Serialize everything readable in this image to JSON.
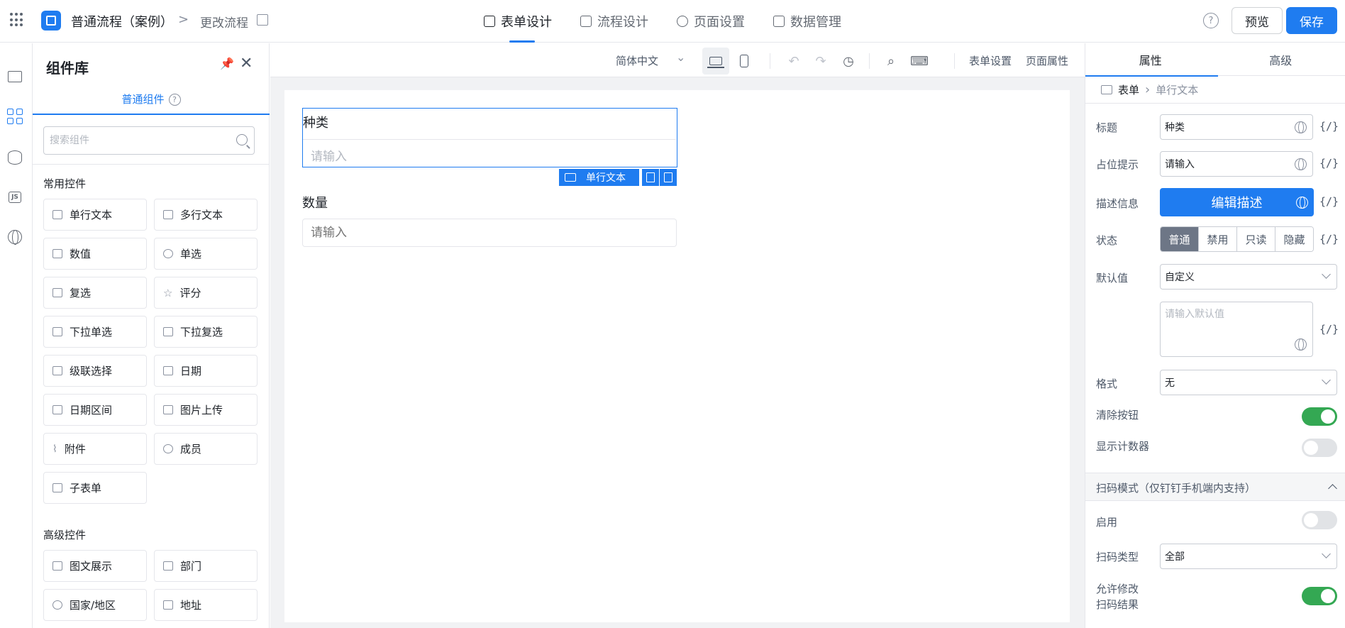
{
  "header": {
    "app_name": "普通流程（案例）",
    "breadcrumb_sep": ">",
    "current_page": "更改流程",
    "tabs": [
      {
        "label": "表单设计",
        "active": true
      },
      {
        "label": "流程设计",
        "active": false
      },
      {
        "label": "页面设置",
        "active": false
      },
      {
        "label": "数据管理",
        "active": false
      }
    ],
    "help": "?",
    "preview_label": "预览",
    "save_label": "保存"
  },
  "rail": {
    "js_label": "JS"
  },
  "library": {
    "title": "组件库",
    "tab_label": "普通组件",
    "help": "?",
    "search_placeholder": "搜索组件",
    "common_title": "常用控件",
    "common_items": [
      "单行文本",
      "多行文本",
      "数值",
      "单选",
      "复选",
      "评分",
      "下拉单选",
      "下拉复选",
      "级联选择",
      "日期",
      "日期区间",
      "图片上传",
      "附件",
      "成员",
      "子表单"
    ],
    "advanced_title": "高级控件",
    "advanced_items": [
      "图文展示",
      "部门",
      "国家/地区",
      "地址"
    ]
  },
  "toolbar": {
    "language": "简体中文",
    "form_settings": "表单设置",
    "page_props": "页面属性"
  },
  "canvas": {
    "fields": [
      {
        "label": "种类",
        "placeholder": "请输入",
        "selected": true
      },
      {
        "label": "数量",
        "placeholder": "请输入",
        "selected": false
      }
    ],
    "selected_tag": "单行文本"
  },
  "props": {
    "tabs": [
      {
        "label": "属性",
        "active": true
      },
      {
        "label": "高级",
        "active": false
      }
    ],
    "breadcrumb": {
      "root": "表单",
      "current": "单行文本"
    },
    "rows": {
      "title_label": "标题",
      "title_value": "种类",
      "placeholder_label": "占位提示",
      "placeholder_value": "请输入",
      "desc_label": "描述信息",
      "desc_button": "编辑描述",
      "status_label": "状态",
      "status_options": [
        "普通",
        "禁用",
        "只读",
        "隐藏"
      ],
      "status_selected": "普通",
      "default_label": "默认值",
      "default_value": "自定义",
      "default_placeholder": "请输入默认值",
      "format_label": "格式",
      "format_value": "无",
      "clear_label": "清除按钮",
      "clear_on": true,
      "counter_label": "显示计数器",
      "counter_on": false,
      "scan_section": "扫码模式（仅钉钉手机端内支持）",
      "enable_label": "启用",
      "enable_on": false,
      "scan_type_label": "扫码类型",
      "scan_type_value": "全部",
      "allow_edit_label_1": "允许修改",
      "allow_edit_label_2": "扫码结果",
      "allow_edit_on": true
    },
    "fx": "{/}"
  }
}
